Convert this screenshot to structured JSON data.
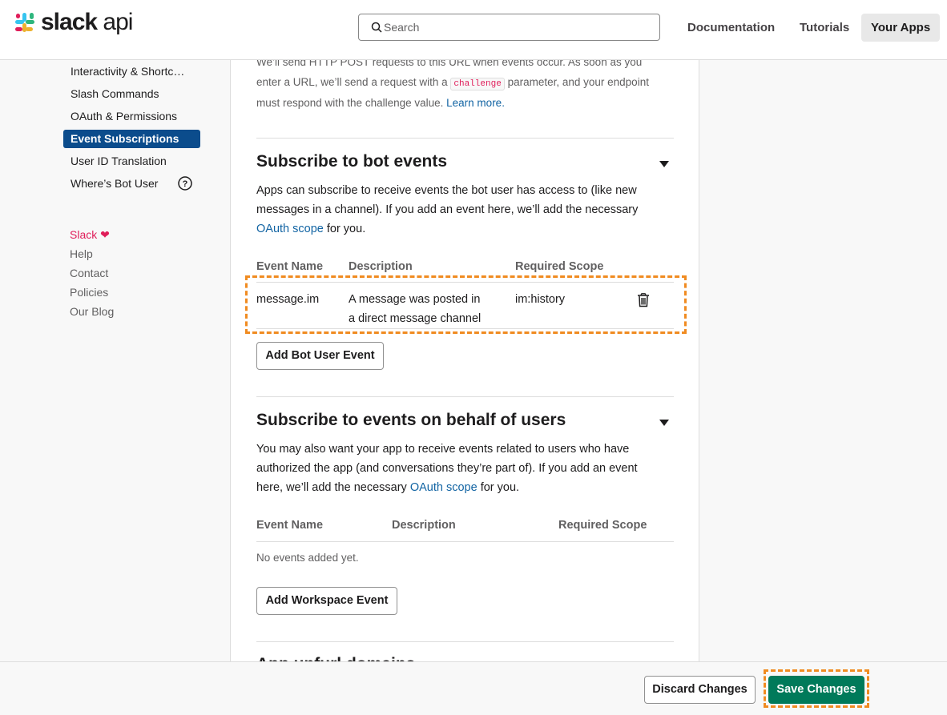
{
  "header": {
    "logo_text": "slack",
    "logo_suffix": "api",
    "search_placeholder": "Search",
    "nav": [
      "Documentation",
      "Tutorials",
      "Your Apps"
    ]
  },
  "sidebar": {
    "items": [
      {
        "label": "Interactivity & Shortc…",
        "active": false
      },
      {
        "label": "Slash Commands",
        "active": false
      },
      {
        "label": "OAuth & Permissions",
        "active": false
      },
      {
        "label": "Event Subscriptions",
        "active": true
      },
      {
        "label": "User ID Translation",
        "active": false
      },
      {
        "label": "Where’s Bot User",
        "active": false
      }
    ],
    "footer": {
      "slack": "Slack",
      "heart": "❤",
      "links": [
        "Help",
        "Contact",
        "Policies",
        "Our Blog"
      ]
    }
  },
  "request_url": {
    "text_1": "We’ll send HTTP POST requests to this URL when events occur. As soon as you",
    "text_2a": "enter a URL, we’ll send a request with a",
    "code": "challenge",
    "text_2b": "parameter, and your endpoint",
    "text_3": "must respond with the challenge value.",
    "learn_more": "Learn more."
  },
  "bot_events": {
    "title": "Subscribe to bot events",
    "desc_1": "Apps can subscribe to receive events the bot user has access to (like new",
    "desc_2": "messages in a channel). If you add an event here, we’ll add the necessary",
    "desc_3_link": "OAuth scope",
    "desc_3_rest": "for you.",
    "columns": [
      "Event Name",
      "Description",
      "Required Scope"
    ],
    "rows": [
      {
        "name": "message.im",
        "desc_1": "A message was posted in",
        "desc_2": "a direct message channel",
        "scope": "im:history"
      }
    ],
    "add_button": "Add Bot User Event"
  },
  "user_events": {
    "title": "Subscribe to events on behalf of users",
    "desc_1": "You may also want your app to receive events related to users who have",
    "desc_2": "authorized the app (and conversations they’re part of). If you add an event",
    "desc_3a": "here, we’ll add the necessary",
    "desc_3_link": "OAuth scope",
    "desc_3_rest": "for you.",
    "columns": [
      "Event Name",
      "Description",
      "Required Scope"
    ],
    "empty": "No events added yet.",
    "add_button": "Add Workspace Event"
  },
  "next_section_partial": "App unfurl domains",
  "footer_bar": {
    "discard": "Discard Changes",
    "save": "Save Changes"
  },
  "colors": {
    "accent_blue": "#1264a3",
    "active_nav": "#0b4c8c",
    "save_green": "#007a5a",
    "highlight_orange": "#f08b21"
  }
}
